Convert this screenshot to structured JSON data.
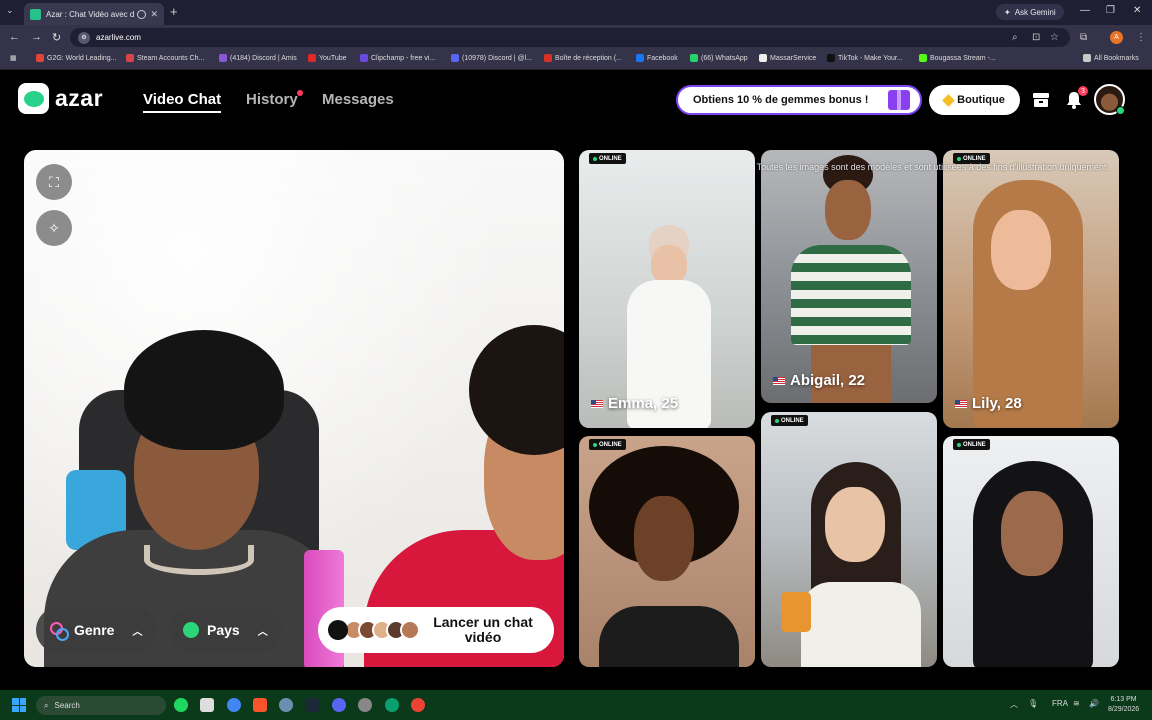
{
  "browser": {
    "tab_title": "Azar : Chat Vidéo avec de n",
    "url": "azarlive.com",
    "ask_gemini": "Ask Gemini",
    "bookmarks": [
      {
        "label": "G2G: World Leading...",
        "color": "#e0453a"
      },
      {
        "label": "Steam Accounts Ch...",
        "color": "#d9434a"
      },
      {
        "label": "(4184) Discord | Amis",
        "color": "#8a55d8"
      },
      {
        "label": "YouTube",
        "color": "#e02a2a"
      },
      {
        "label": "Clipchamp - free vi...",
        "color": "#6a4ae0"
      },
      {
        "label": "(10978) Discord | @l...",
        "color": "#5865f2"
      },
      {
        "label": "Boîte de réception (...",
        "color": "#d93025"
      },
      {
        "label": "Facebook",
        "color": "#1877f2"
      },
      {
        "label": "(66) WhatsApp",
        "color": "#25d366"
      },
      {
        "label": "MassarService",
        "color": "#eeeeee"
      },
      {
        "label": "TikTok - Make Your...",
        "color": "#111111"
      },
      {
        "label": "Bougassa Stream -...",
        "color": "#53fc18"
      }
    ],
    "all_bookmarks": "All Bookmarks"
  },
  "app": {
    "logo_text": "azar",
    "nav": {
      "video_chat": "Video Chat",
      "history": "History",
      "messages": "Messages"
    },
    "promo_text": "Obtiens 10 % de gemmes bonus !",
    "boutique_label": "Boutique",
    "notification_count": "3"
  },
  "selfcam": {
    "genre_label": "Genre",
    "pays_label": "Pays",
    "launch_label": "Lancer un chat vidéo"
  },
  "gallery": {
    "disclaimer": "Toutes les images sont des modèles et sont utilisées à des fins d'illustration uniquement.",
    "online_label": "ONLINE",
    "cards": [
      {
        "name": "Emma, 25"
      },
      {
        "name": "Abigail, 22"
      },
      {
        "name": "Lily, 28"
      }
    ]
  },
  "taskbar": {
    "search_label": "Search",
    "lang": "FRA",
    "time": "6:13 PM",
    "date": "8/29/2026"
  },
  "colors": {
    "accent_green": "#28d18a",
    "promo_border": "#7b46f0",
    "notification_red": "#ff3d5b"
  }
}
